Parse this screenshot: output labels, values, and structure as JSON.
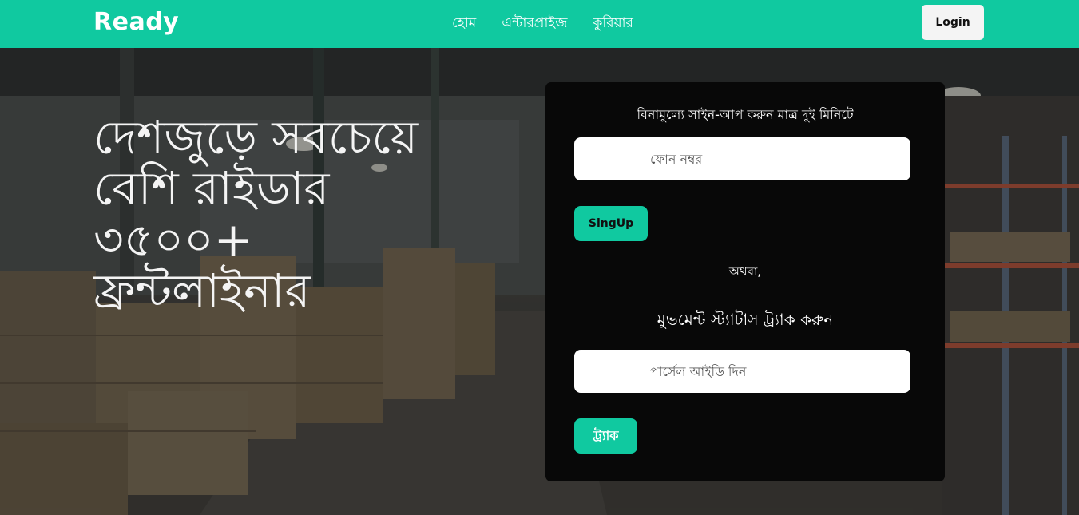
{
  "navbar": {
    "brand": "Ready",
    "links": [
      "হোম",
      "এন্টারপ্রাইজ",
      "কুরিয়ার"
    ],
    "login_label": "Login",
    "background_color": "#10c9a0"
  },
  "hero": {
    "title_lines": [
      "দেশজুড়ে সবচেয়ে",
      "বেশি রাইডার",
      "৩৫০০+",
      "ফ্রন্টলাইনার"
    ],
    "background_image": "warehouse-photo"
  },
  "signup_card": {
    "heading": "বিনামুল্যে সাইন-আপ করুন মাত্র দুই মিনিটে",
    "phone_placeholder": "ফোন নম্বর",
    "signup_label": "SingUp",
    "or_text": "অথবা,",
    "track_heading": "মুভমেন্ট স্ট্যাটাস ট্র্যাক করুন",
    "parcel_placeholder": "পার্সেল আইডি দিন",
    "track_label": "ট্র্যাক",
    "accent_color": "#10c9a0"
  }
}
